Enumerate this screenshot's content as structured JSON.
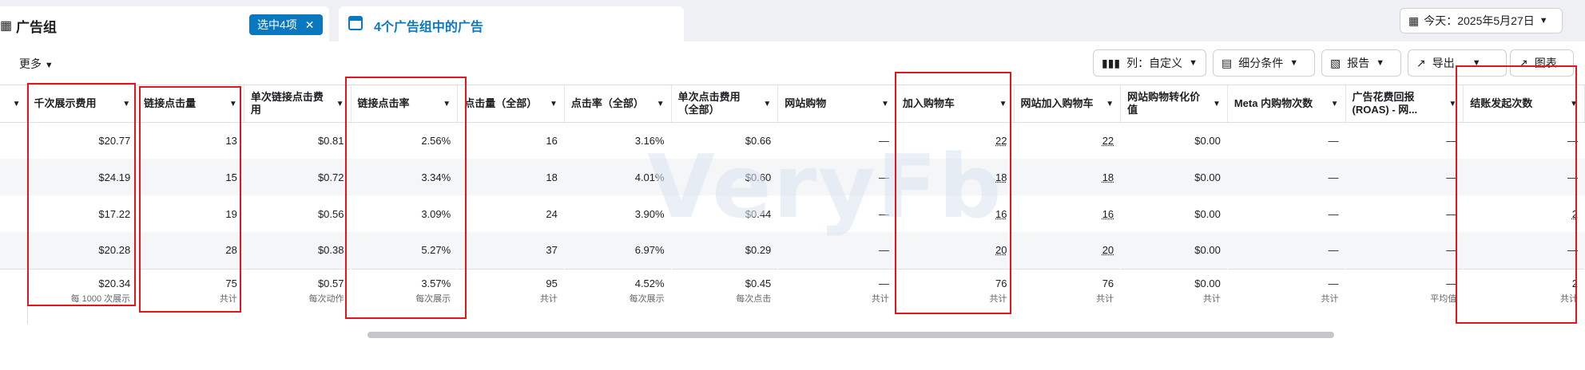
{
  "tabs": {
    "adgroup_title": "广告组",
    "selected_badge": "选中4项",
    "ads_title": "4个广告组中的广告"
  },
  "date_range": "今天：2025年5月27日",
  "toolbar": {
    "more": "更多",
    "columns": "列：自定义",
    "breakdown": "细分条件",
    "reports": "报告",
    "export": "导出",
    "charts": "图表"
  },
  "columns": [
    {
      "label": "千次展示费用"
    },
    {
      "label": "链接点击量"
    },
    {
      "label": "单次链接点击费用"
    },
    {
      "label": "链接点击率"
    },
    {
      "label": "点击量（全部）"
    },
    {
      "label": "点击率（全部）"
    },
    {
      "label": "单次点击费用（全部）"
    },
    {
      "label": "网站购物"
    },
    {
      "label": "加入购物车"
    },
    {
      "label": "网站加入购物车"
    },
    {
      "label": "网站购物转化价值"
    },
    {
      "label": "Meta 内购物次数"
    },
    {
      "label": "广告花费回报 (ROAS) - 网..."
    },
    {
      "label": "结账发起次数"
    }
  ],
  "rows": [
    [
      "$20.77",
      "13",
      "$0.81",
      "2.56%",
      "16",
      "3.16%",
      "$0.66",
      "—",
      "22",
      "22",
      "$0.00",
      "—",
      "—",
      "—"
    ],
    [
      "$24.19",
      "15",
      "$0.72",
      "3.34%",
      "18",
      "4.01%",
      "$0.60",
      "—",
      "18",
      "18",
      "$0.00",
      "—",
      "—",
      "—"
    ],
    [
      "$17.22",
      "19",
      "$0.56",
      "3.09%",
      "24",
      "3.90%",
      "$0.44",
      "—",
      "16",
      "16",
      "$0.00",
      "—",
      "—",
      "2"
    ],
    [
      "$20.28",
      "28",
      "$0.38",
      "5.27%",
      "37",
      "6.97%",
      "$0.29",
      "—",
      "20",
      "20",
      "$0.00",
      "—",
      "—",
      "—"
    ]
  ],
  "totals": [
    {
      "value": "$20.34",
      "sub": "每 1000 次展示"
    },
    {
      "value": "75",
      "sub": "共计"
    },
    {
      "value": "$0.57",
      "sub": "每次动作"
    },
    {
      "value": "3.57%",
      "sub": "每次展示"
    },
    {
      "value": "95",
      "sub": "共计"
    },
    {
      "value": "4.52%",
      "sub": "每次展示"
    },
    {
      "value": "$0.45",
      "sub": "每次点击"
    },
    {
      "value": "—",
      "sub": "共计"
    },
    {
      "value": "76",
      "sub": "共计"
    },
    {
      "value": "76",
      "sub": "共计"
    },
    {
      "value": "$0.00",
      "sub": "共计"
    },
    {
      "value": "—",
      "sub": "共计"
    },
    {
      "value": "—",
      "sub": "平均值"
    },
    {
      "value": "2",
      "sub": "共计"
    }
  ],
  "watermark": "VeryFb",
  "colors": {
    "accent": "#0a78be",
    "highlight": "#e5161b"
  }
}
